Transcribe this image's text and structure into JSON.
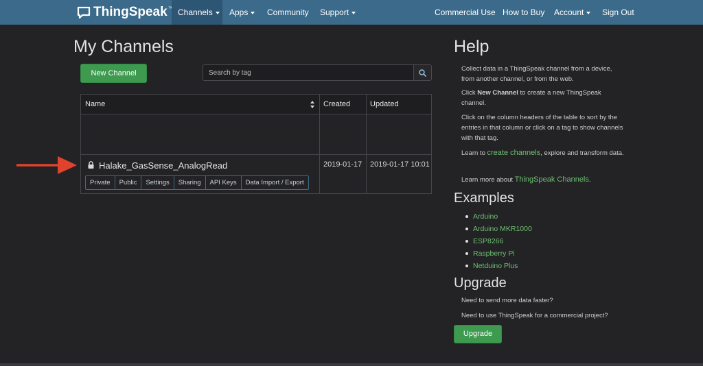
{
  "nav": {
    "brand": "ThingSpeak",
    "brand_tm": "™",
    "items": [
      {
        "label": "Channels",
        "dropdown": true,
        "active": true
      },
      {
        "label": "Apps",
        "dropdown": true
      },
      {
        "label": "Community",
        "dropdown": false
      },
      {
        "label": "Support",
        "dropdown": true
      },
      {
        "label": "Commercial Use",
        "dropdown": false
      },
      {
        "label": "How to Buy",
        "dropdown": false
      },
      {
        "label": "Account",
        "dropdown": true
      },
      {
        "label": "Sign Out",
        "dropdown": false
      }
    ]
  },
  "main": {
    "title": "My Channels",
    "new_channel_label": "New Channel",
    "search_placeholder": "Search by tag",
    "table": {
      "columns": [
        "Name",
        "Created",
        "Updated"
      ],
      "rows": [
        {
          "name": "Halake_GasSense_AnalogRead",
          "created": "2019-01-17",
          "updated": "2019-01-17 10:01",
          "actions": [
            "Private",
            "Public",
            "Settings",
            "Sharing",
            "API Keys",
            "Data Import / Export"
          ]
        }
      ]
    }
  },
  "help": {
    "title": "Help",
    "p1": "Collect data in a ThingSpeak channel from a device, from another channel, or from the web.",
    "p2_pre": "Click ",
    "p2_bold": "New Channel",
    "p2_post": " to create a new ThingSpeak channel.",
    "p3": "Click on the column headers of the table to sort by the entries in that column or click on a tag to show channels with that tag.",
    "p4_pre": "Learn to ",
    "p4_link": "create channels",
    "p4_post": ", explore and transform data.",
    "p5_pre": "Learn more about ",
    "p5_link": "ThingSpeak Channels",
    "p5_post": "."
  },
  "examples": {
    "title": "Examples",
    "items": [
      "Arduino",
      "Arduino MKR1000",
      "ESP8266",
      "Raspberry Pi",
      "Netduino Plus"
    ]
  },
  "upgrade": {
    "title": "Upgrade",
    "q1": "Need to send more data faster?",
    "q2": "Need to use ThingSpeak for a commercial project?",
    "button_label": "Upgrade"
  },
  "colors": {
    "navbar": "#3b6a8a",
    "accent_green": "#3d9a4f",
    "link_green": "#6cbf6f",
    "annotation_arrow": "#e0422b",
    "background": "#232326"
  },
  "icons": [
    "chat-bubble-logo-icon",
    "caret-down-icon",
    "search-icon",
    "sort-icon",
    "lock-icon",
    "red-arrow-annotation"
  ]
}
